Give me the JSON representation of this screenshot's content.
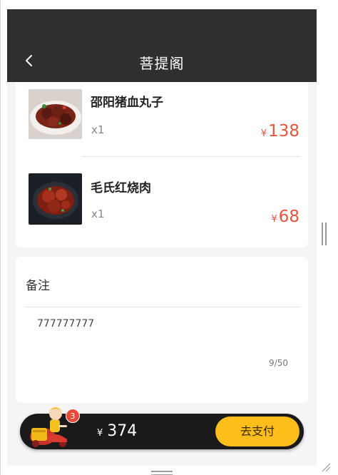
{
  "header": {
    "title": "菩提阁",
    "back_icon": "chevron-left-icon"
  },
  "order": {
    "items": [
      {
        "name": "邵阳猪血丸子",
        "qty": "x1",
        "currency": "¥",
        "price": "138"
      },
      {
        "name": "毛氏红烧肉",
        "qty": "x1",
        "currency": "¥",
        "price": "68"
      }
    ]
  },
  "remark": {
    "label": "备注",
    "text": "777777777",
    "count": "9/50"
  },
  "cart": {
    "badge": "3",
    "currency": "¥",
    "total": "374",
    "pay_label": "去支付",
    "icon": "courier-icon"
  },
  "colors": {
    "header_bg": "#2f2f2f",
    "price": "#e8553f",
    "pay_button": "#fdbd1a",
    "cart_bar": "#1a1a1a",
    "badge": "#e84a3a",
    "page_bg": "#f5f5f7"
  }
}
